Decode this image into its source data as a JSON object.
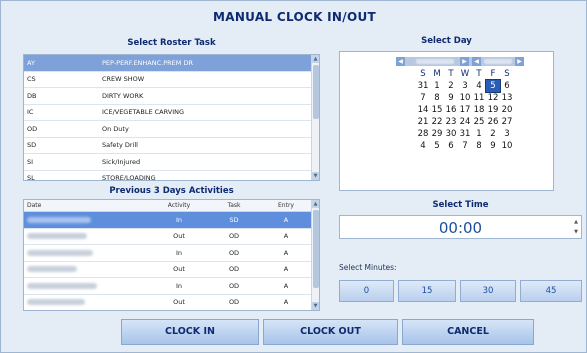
{
  "title": "MANUAL CLOCK IN/OUT",
  "roster": {
    "label": "Select Roster Task",
    "items": [
      {
        "code": "AY",
        "desc": "PEP-PERF.ENHANC.PREM DR",
        "selected": true
      },
      {
        "code": "CS",
        "desc": "CREW SHOW"
      },
      {
        "code": "DB",
        "desc": "DIRTY WORK"
      },
      {
        "code": "IC",
        "desc": "ICE/VEGETABLE CARVING"
      },
      {
        "code": "OD",
        "desc": "On Duty"
      },
      {
        "code": "SD",
        "desc": "Safety Drill"
      },
      {
        "code": "SI",
        "desc": "Sick/Injured"
      },
      {
        "code": "SL",
        "desc": "STORE/LOADING"
      }
    ]
  },
  "activities": {
    "label": "Previous 3 Days Activities",
    "columns": [
      "Date",
      "Activity",
      "Task",
      "Entry"
    ],
    "rows": [
      {
        "activity": "In",
        "task": "SD",
        "entry": "A",
        "selected": true
      },
      {
        "activity": "Out",
        "task": "OD",
        "entry": "A"
      },
      {
        "activity": "In",
        "task": "OD",
        "entry": "A"
      },
      {
        "activity": "Out",
        "task": "OD",
        "entry": "A"
      },
      {
        "activity": "In",
        "task": "OD",
        "entry": "A"
      },
      {
        "activity": "Out",
        "task": "OD",
        "entry": "A"
      }
    ]
  },
  "calendar": {
    "label": "Select Day",
    "prev_icon": "◀",
    "next_icon": "▶",
    "weekdays": [
      "S",
      "M",
      "T",
      "W",
      "T",
      "F",
      "S"
    ],
    "weeks": [
      [
        "31",
        "1",
        "2",
        "3",
        "4",
        "5",
        "6"
      ],
      [
        "7",
        "8",
        "9",
        "10",
        "11",
        "12",
        "13"
      ],
      [
        "14",
        "15",
        "16",
        "17",
        "18",
        "19",
        "20"
      ],
      [
        "21",
        "22",
        "23",
        "24",
        "25",
        "26",
        "27"
      ],
      [
        "28",
        "29",
        "30",
        "31",
        "1",
        "2",
        "3"
      ],
      [
        "4",
        "5",
        "6",
        "7",
        "8",
        "9",
        "10"
      ]
    ],
    "selected_day": "5"
  },
  "time": {
    "label": "Select Time",
    "value": "00:00"
  },
  "minutes": {
    "label": "Select Minutes:",
    "options": [
      "0",
      "15",
      "30",
      "45"
    ]
  },
  "actions": {
    "clock_in": "CLOCK IN",
    "clock_out": "CLOCK OUT",
    "cancel": "CANCEL"
  },
  "colors": {
    "selected_row": "#7da1d8",
    "selected_day": "#2c5db5",
    "title": "#0e2b70"
  }
}
